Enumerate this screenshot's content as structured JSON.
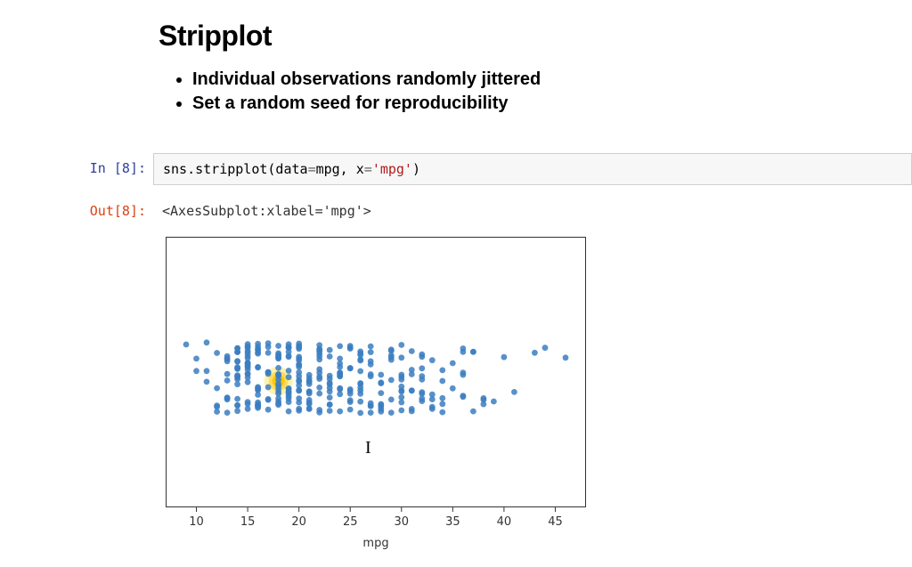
{
  "heading": "Stripplot",
  "bullets": [
    "Individual observations randomly jittered",
    "Set a random seed for reproducibility"
  ],
  "cell": {
    "in_prompt": "In [8]:",
    "out_prompt": "Out[8]:",
    "code_prefix": "sns.stripplot(data",
    "code_eq1": "=",
    "code_mid": "mpg, x",
    "code_eq2": "=",
    "code_str": "'mpg'",
    "code_suffix": ")",
    "out_text": "<AxesSubplot:xlabel='mpg'>"
  },
  "chart_data": {
    "type": "scatter",
    "title": "",
    "xlabel": "mpg",
    "ylabel": "",
    "xlim": [
      7,
      48
    ],
    "xticks": [
      10,
      15,
      20,
      25,
      30,
      35,
      40,
      45
    ],
    "jitter_band": [
      -0.35,
      0.35
    ],
    "point_color": "#3b7ec1",
    "cursor_marker_x": 18,
    "values": [
      9,
      10,
      10,
      11,
      11,
      11,
      12,
      12,
      12,
      12,
      12,
      13,
      13,
      13,
      13,
      13,
      13,
      13,
      13,
      13,
      13,
      14,
      14,
      14,
      14,
      14,
      14,
      14,
      14,
      14,
      14,
      14,
      14,
      14,
      14,
      14,
      14,
      14,
      14,
      14,
      15,
      15,
      15,
      15,
      15,
      15,
      15,
      15,
      15,
      15,
      15,
      15,
      15,
      15,
      15,
      15,
      15,
      15,
      15,
      15,
      15,
      16,
      16,
      16,
      16,
      16,
      16,
      16,
      16,
      16,
      16,
      16,
      16,
      16,
      16,
      16,
      16,
      16,
      16,
      16,
      16,
      17,
      17,
      17,
      17,
      17,
      17,
      17,
      17,
      17,
      17,
      17,
      18,
      18,
      18,
      18,
      18,
      18,
      18,
      18,
      18,
      18,
      18,
      18,
      18,
      18,
      18,
      18,
      18,
      18,
      18,
      18,
      18,
      19,
      19,
      19,
      19,
      19,
      19,
      19,
      19,
      19,
      19,
      19,
      19,
      19,
      19,
      19,
      19,
      19,
      19,
      20,
      20,
      20,
      20,
      20,
      20,
      20,
      20,
      20,
      20,
      20,
      20,
      20,
      20,
      20,
      20,
      20,
      20,
      20,
      20,
      20,
      21,
      21,
      21,
      21,
      21,
      21,
      21,
      21,
      21,
      21,
      21,
      21,
      21,
      22,
      22,
      22,
      22,
      22,
      22,
      22,
      22,
      22,
      22,
      22,
      22,
      22,
      22,
      22,
      23,
      23,
      23,
      23,
      23,
      23,
      23,
      23,
      23,
      23,
      23,
      23,
      24,
      24,
      24,
      24,
      24,
      24,
      24,
      24,
      24,
      24,
      24,
      24,
      24,
      25,
      25,
      25,
      25,
      25,
      25,
      25,
      25,
      25,
      25,
      25,
      25,
      26,
      26,
      26,
      26,
      26,
      26,
      26,
      26,
      26,
      26,
      26,
      26,
      26,
      27,
      27,
      27,
      27,
      27,
      27,
      27,
      27,
      27,
      27,
      28,
      28,
      28,
      28,
      28,
      28,
      28,
      28,
      28,
      29,
      29,
      29,
      29,
      29,
      29,
      29,
      29,
      30,
      30,
      30,
      30,
      30,
      30,
      30,
      30,
      30,
      30,
      30,
      31,
      31,
      31,
      31,
      31,
      31,
      31,
      32,
      32,
      32,
      32,
      32,
      32,
      32,
      32,
      32,
      33,
      33,
      33,
      33,
      33,
      34,
      34,
      34,
      34,
      34,
      35,
      35,
      36,
      36,
      36,
      36,
      36,
      36,
      37,
      37,
      37,
      38,
      38,
      38,
      39,
      40,
      41,
      43,
      44,
      46
    ]
  }
}
